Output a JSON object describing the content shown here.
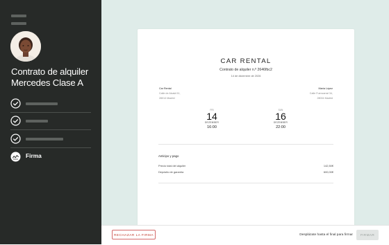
{
  "sidebar": {
    "title_line1": "Contrato de alquiler",
    "title_line2": "Mercedes Clase A",
    "steps": [
      {
        "state": "completed"
      },
      {
        "state": "completed"
      },
      {
        "state": "completed"
      },
      {
        "state": "current",
        "label": "Firma"
      }
    ]
  },
  "document": {
    "company": "CAR RENTAL",
    "contract_number": "Contrato de alquiler n.º 2646fbc2",
    "date": "14 de diciembre de 2026",
    "lessor": {
      "name": "Car Rental",
      "address_line1": "Calle de Alcalá 51,",
      "address_line2": "28014 Madrid"
    },
    "lessee": {
      "name": "María López",
      "address_line1": "Calle Fuencarral 34,",
      "address_line2": "28004 Madrid"
    },
    "pickup": {
      "weekday": "FRI",
      "day": "14",
      "month": "DEZEMBER",
      "time": "16:00"
    },
    "return": {
      "weekday": "SUN",
      "day": "16",
      "month": "DEZEMBER",
      "time": "22:00"
    },
    "payment": {
      "title": "Anticipo y pago",
      "total_label": "Precio total del alquiler",
      "total_value": "142,50€",
      "deposit_label": "Depósito de garantía",
      "deposit_value": "600,00€"
    }
  },
  "footer": {
    "reject_label": "RECHAZAR LA FIRMA",
    "scroll_hint": "Desplázate hasta el final para firmar",
    "sign_label": "FIRMAR"
  },
  "colors": {
    "sidebar_bg": "#272a28",
    "main_bg": "#dfece9",
    "reject_accent": "#c0392b",
    "disabled_button": "#e2e5e4"
  },
  "icons": {
    "step_done": "check-circle-icon",
    "step_current": "signature-icon"
  }
}
